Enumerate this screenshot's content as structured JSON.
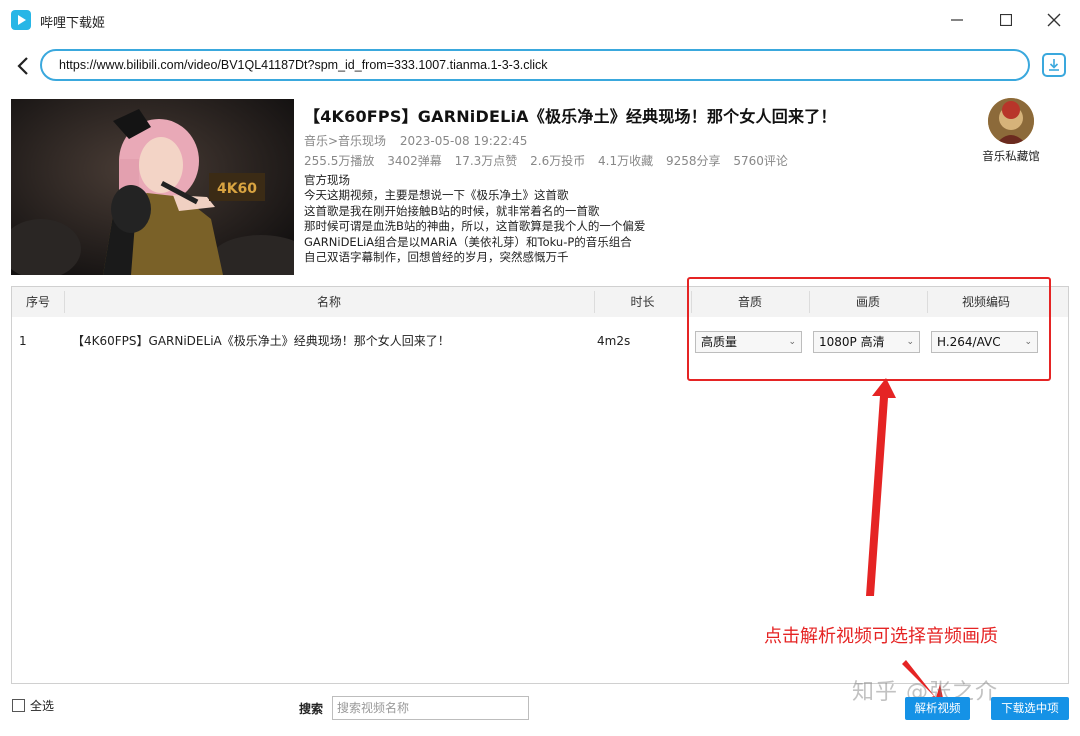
{
  "window": {
    "title": "哔哩下载姬",
    "minimize": "—",
    "maximize": "☐",
    "close": "✕"
  },
  "address": {
    "url": "https://www.bilibili.com/video/BV1QL41187Dt?spm_id_from=333.1007.tianma.1-3-3.click"
  },
  "video": {
    "title": "【4K60FPS】GARNiDELiA《极乐净土》经典现场！那个女人回来了！",
    "category": "音乐>音乐现场",
    "date": "2023-05-08 19:22:45",
    "stats": [
      "255.5万播放",
      "3402弹幕",
      "17.3万点赞",
      "2.6万投币",
      "4.1万收藏",
      "9258分享",
      "5760评论"
    ],
    "description": [
      "官方现场",
      "今天这期视频，主要是想说一下《极乐净土》这首歌",
      "这首歌是我在刚开始接触B站的时候，就非常着名的一首歌",
      "那时候可谓是血洗B站的神曲，所以，这首歌算是我个人的一个偏爱",
      "GARNiDELiA组合是以MARiA（美依礼芽）和Toku-P的音乐组合",
      "自己双语字幕制作，回想曾经的岁月，突然感慨万千"
    ],
    "thumbnail_badge": "4K60"
  },
  "uploader": {
    "name": "音乐私藏馆"
  },
  "table": {
    "headers": [
      "序号",
      "名称",
      "时长",
      "音质",
      "画质",
      "视频编码"
    ],
    "rows": [
      {
        "index": "1",
        "name": "【4K60FPS】GARNiDELiA《极乐净土》经典现场！那个女人回来了！",
        "duration": "4m2s",
        "audio_quality": "高质量",
        "video_quality": "1080P 高清",
        "codec": "H.264/AVC"
      }
    ]
  },
  "annotation": {
    "text": "点击解析视频可选择音频画质",
    "color": "#e52424"
  },
  "footer": {
    "select_all": "全选",
    "search_label": "搜索",
    "search_placeholder": "搜索视频名称",
    "watermark": "知乎 @张之介",
    "parse_button": "解析视频",
    "download_button": "下载选中项"
  },
  "colors": {
    "accent": "#3aa8dd",
    "button": "#1592e6",
    "annotation": "#e52424"
  }
}
